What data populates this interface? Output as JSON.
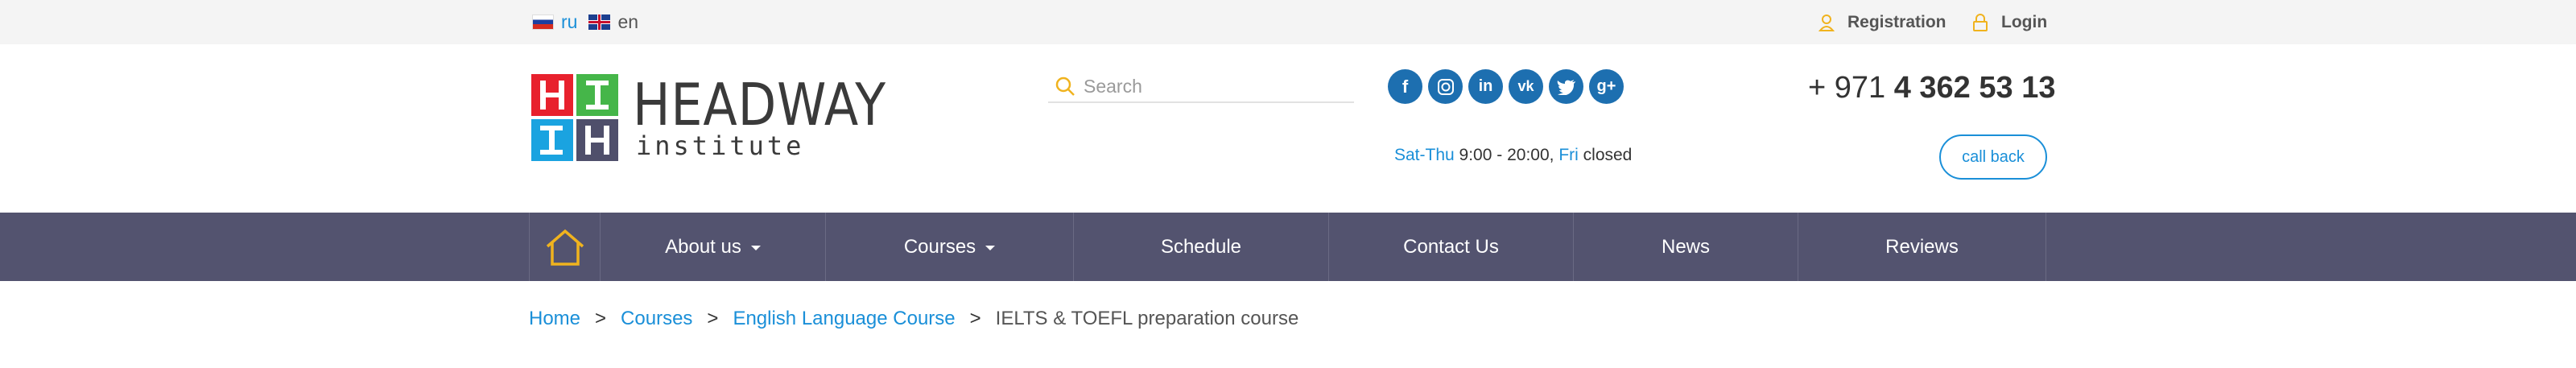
{
  "lang": {
    "ru_label": "ru",
    "en_label": "en"
  },
  "auth": {
    "registration_label": "Registration",
    "login_label": "Login"
  },
  "logo": {
    "name": "HEADWAY",
    "sub": "institute",
    "letters": [
      "H",
      "I",
      "I",
      "H"
    ]
  },
  "search": {
    "placeholder": "Search"
  },
  "social": [
    "facebook-icon",
    "instagram-icon",
    "linkedin-icon",
    "vk-icon",
    "twitter-icon",
    "google-plus-icon"
  ],
  "hours": {
    "days1": "Sat-Thu",
    "time": "9:00 - 20:00,",
    "days2": "Fri",
    "closed": "closed"
  },
  "phone": {
    "prefix": "+ 971",
    "number": "4 362 53 13"
  },
  "callback": {
    "label": "call back"
  },
  "nav": {
    "items": [
      {
        "label": "About us"
      },
      {
        "label": "Courses"
      },
      {
        "label": "Schedule"
      },
      {
        "label": "Contact Us"
      },
      {
        "label": "News"
      },
      {
        "label": "Reviews"
      }
    ]
  },
  "breadcrumb": {
    "items": [
      "Home",
      "Courses",
      "English Language Course"
    ],
    "separator": ">",
    "current": "IELTS & TOEFL preparation course"
  },
  "colors": {
    "accent": "#1a8fd8",
    "nav_bg": "#53536f",
    "home_icon": "#f0b31e"
  }
}
